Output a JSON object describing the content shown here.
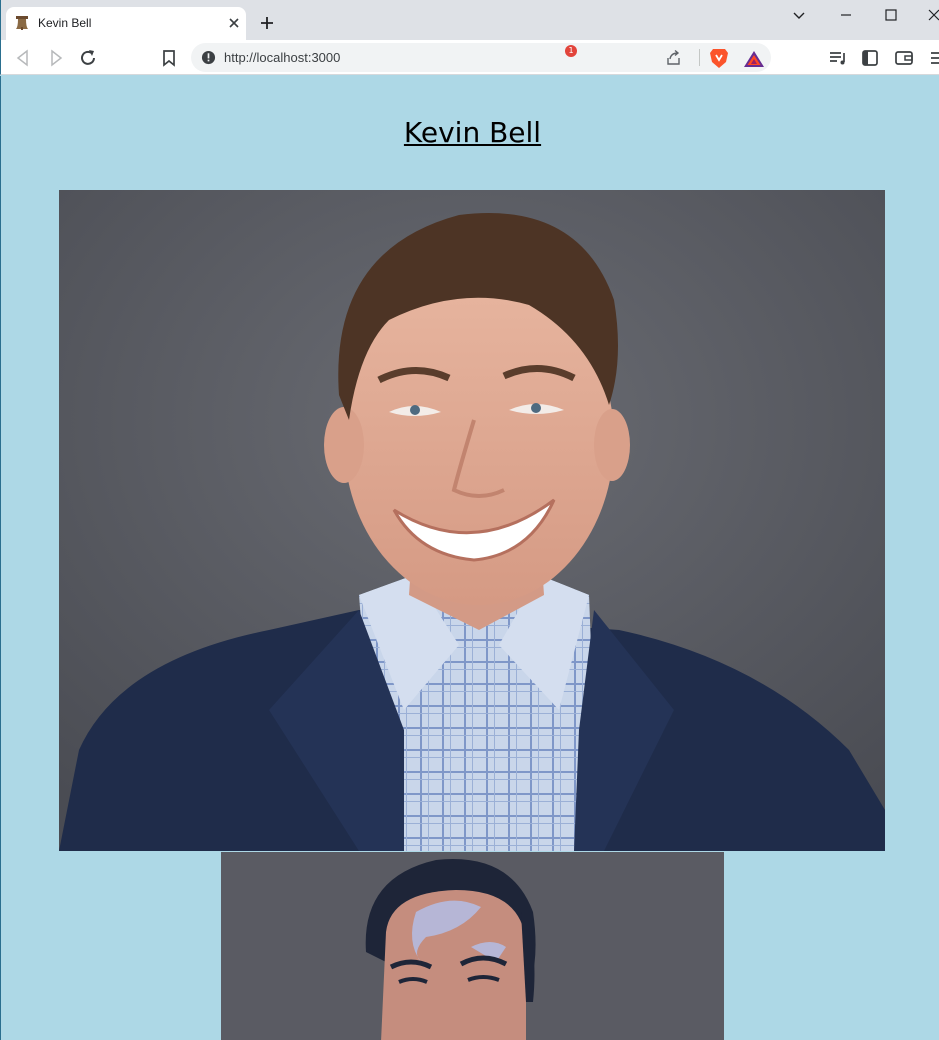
{
  "browser": {
    "tab_title": "Kevin Bell",
    "url": "http://localhost:3000",
    "notification_count": "1"
  },
  "page": {
    "heading": "Kevin Bell"
  },
  "colors": {
    "page_background": "#add8e6",
    "photo_background": "#5d6068",
    "poster_background": "#5a5b63"
  }
}
